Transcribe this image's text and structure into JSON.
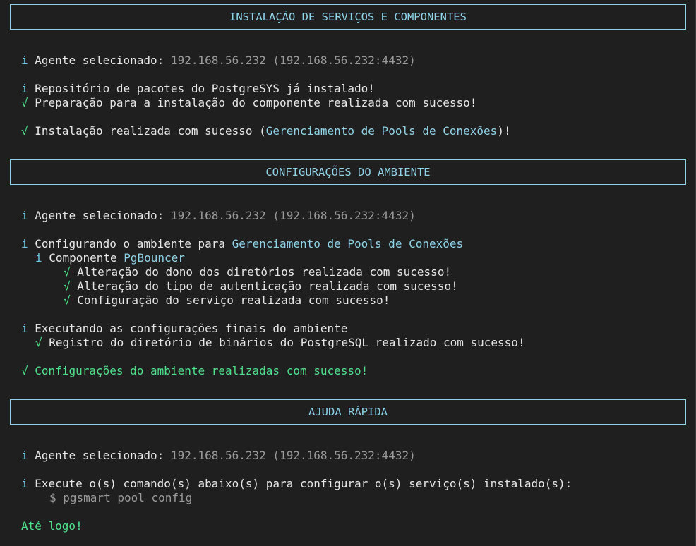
{
  "sections": {
    "install": {
      "title": "INSTALAÇÃO DE SERVIÇOS E COMPONENTES",
      "agent_label": " Agente selecionado: ",
      "agent_value": "192.168.56.232 (192.168.56.232:4432)",
      "repo_line": " Repositório de pacotes do PostgreSYS já instalado!",
      "prep_line": " Preparação para a instalação do componente realizada com sucesso!",
      "result_prefix": " Instalação realizada com sucesso (",
      "result_component": "Gerenciamento de Pools de Conexões",
      "result_suffix": ")!"
    },
    "config": {
      "title": "CONFIGURAÇÕES DO AMBIENTE",
      "agent_label": " Agente selecionado: ",
      "agent_value": "192.168.56.232 (192.168.56.232:4432)",
      "configuring_prefix": " Configurando o ambiente para ",
      "configuring_target": "Gerenciamento de Pools de Conexões",
      "component_prefix": " Componente ",
      "component_name": "PgBouncer",
      "steps": [
        " Alteração do dono dos diretórios realizada com sucesso!",
        " Alteração do tipo de autenticação realizada com sucesso!",
        " Configuração do serviço realizada com sucesso!"
      ],
      "final_line": " Executando as configurações finais do ambiente",
      "registry_line": " Registro do diretório de binários do PostgreSQL realizado com sucesso!",
      "done_line": " Configurações do ambiente realizadas com sucesso!"
    },
    "help": {
      "title": "AJUDA RÁPIDA",
      "agent_label": " Agente selecionado: ",
      "agent_value": "192.168.56.232 (192.168.56.232:4432)",
      "execute_line": " Execute o(s) comando(s) abaixo(s) para configurar o(s) serviço(s) instalado(s):",
      "command": "$ pgsmart pool config",
      "bye": "Até logo!"
    }
  },
  "glyphs": {
    "info": "i",
    "ok": "√"
  },
  "colors": {
    "accent": "#8fd3e8",
    "success": "#4fe08a",
    "muted": "#9a9a9a",
    "background": "#1f1f1f"
  }
}
